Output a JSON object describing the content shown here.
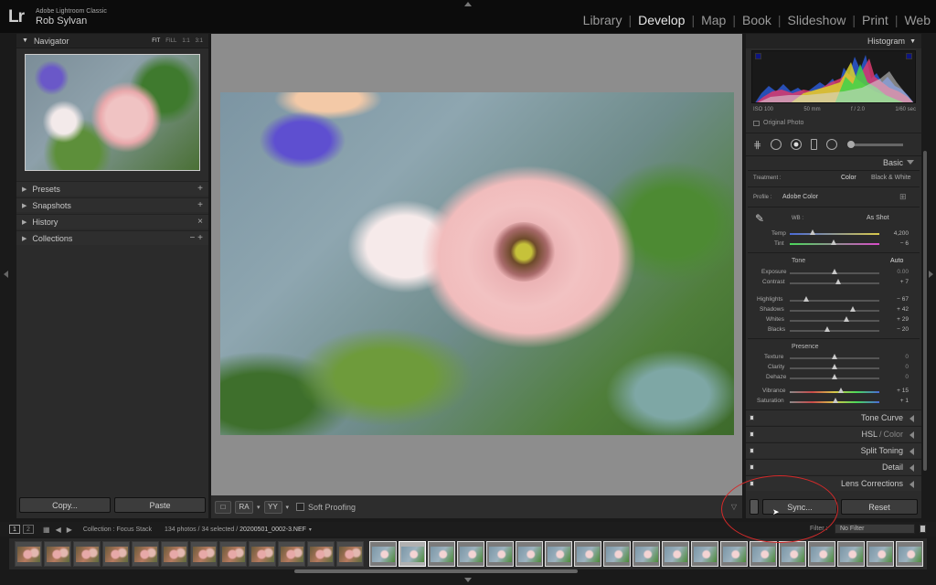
{
  "topbar": {
    "logo": "Lr",
    "app_name": "Adobe Lightroom Classic",
    "user_name": "Rob Sylvan",
    "modules": [
      {
        "label": "Library",
        "active": false
      },
      {
        "label": "Develop",
        "active": true
      },
      {
        "label": "Map",
        "active": false
      },
      {
        "label": "Book",
        "active": false
      },
      {
        "label": "Slideshow",
        "active": false
      },
      {
        "label": "Print",
        "active": false
      },
      {
        "label": "Web",
        "active": false
      }
    ],
    "separator": "|"
  },
  "left_panel": {
    "navigator": {
      "title": "Navigator",
      "zoom_options": [
        "FIT",
        "FILL",
        "1:1",
        "3:1"
      ],
      "active_zoom": "FIT"
    },
    "sections": [
      {
        "label": "Presets",
        "action": "+"
      },
      {
        "label": "Snapshots",
        "action": "+"
      },
      {
        "label": "History",
        "action": "×"
      },
      {
        "label": "Collections",
        "action": "− +"
      }
    ],
    "copy_label": "Copy...",
    "paste_label": "Paste"
  },
  "center_toolbar": {
    "loupe_icon": "□",
    "compare_label": "RA",
    "survey_label": "YY",
    "soft_proofing_label": "Soft Proofing"
  },
  "right_panel": {
    "histogram": {
      "title": "Histogram"
    },
    "camera_info": {
      "iso": "ISO 100",
      "focal": "50 mm",
      "aperture": "f / 2.0",
      "shutter": "1/60 sec"
    },
    "original_photo_label": "Original Photo",
    "basic": {
      "title": "Basic",
      "treatment_label": "Treatment :",
      "treatment_color": "Color",
      "treatment_bw": "Black & White",
      "profile_label": "Profile :",
      "profile_value": "Adobe Color",
      "wb_label": "WB :",
      "wb_value": "As Shot",
      "temp": {
        "label": "Temp",
        "value": "4,200",
        "position": 0.25
      },
      "tint": {
        "label": "Tint",
        "value": "− 6",
        "position": 0.47
      },
      "tone_label": "Tone",
      "auto_label": "Auto",
      "exposure": {
        "label": "Exposure",
        "value": "0.00",
        "position": 0.5
      },
      "contrast": {
        "label": "Contrast",
        "value": "+ 7",
        "position": 0.54
      },
      "highlights": {
        "label": "Highlights",
        "value": "− 67",
        "position": 0.17
      },
      "shadows": {
        "label": "Shadows",
        "value": "+ 42",
        "position": 0.71
      },
      "whites": {
        "label": "Whites",
        "value": "+ 29",
        "position": 0.64
      },
      "blacks": {
        "label": "Blacks",
        "value": "− 20",
        "position": 0.4
      },
      "presence_label": "Presence",
      "texture": {
        "label": "Texture",
        "value": "0",
        "position": 0.5
      },
      "clarity": {
        "label": "Clarity",
        "value": "0",
        "position": 0.5
      },
      "dehaze": {
        "label": "Dehaze",
        "value": "0",
        "position": 0.5
      },
      "vibrance": {
        "label": "Vibrance",
        "value": "+ 15",
        "position": 0.57
      },
      "saturation": {
        "label": "Saturation",
        "value": "+ 1",
        "position": 0.51
      }
    },
    "collapsed_sections": [
      "Tone Curve",
      "HSL",
      "Split Toning",
      "Detail",
      "Lens Corrections"
    ],
    "hsl_suffix": "Color",
    "hsl_sep": "/",
    "sync_label": "Sync...",
    "reset_label": "Reset"
  },
  "filmstrip_bar": {
    "page1": "1",
    "page2": "2",
    "collection": "Collection : Focus Stack",
    "count": "134 photos / 34 selected /",
    "filename": "20200501_0002-3.NEF",
    "filter_label": "Filter :",
    "filter_value": "No Filter"
  },
  "colors": {
    "accent_red": "#d42a2a",
    "panel_bg": "#2b2b2b",
    "center_bg": "#8d8d8d"
  }
}
